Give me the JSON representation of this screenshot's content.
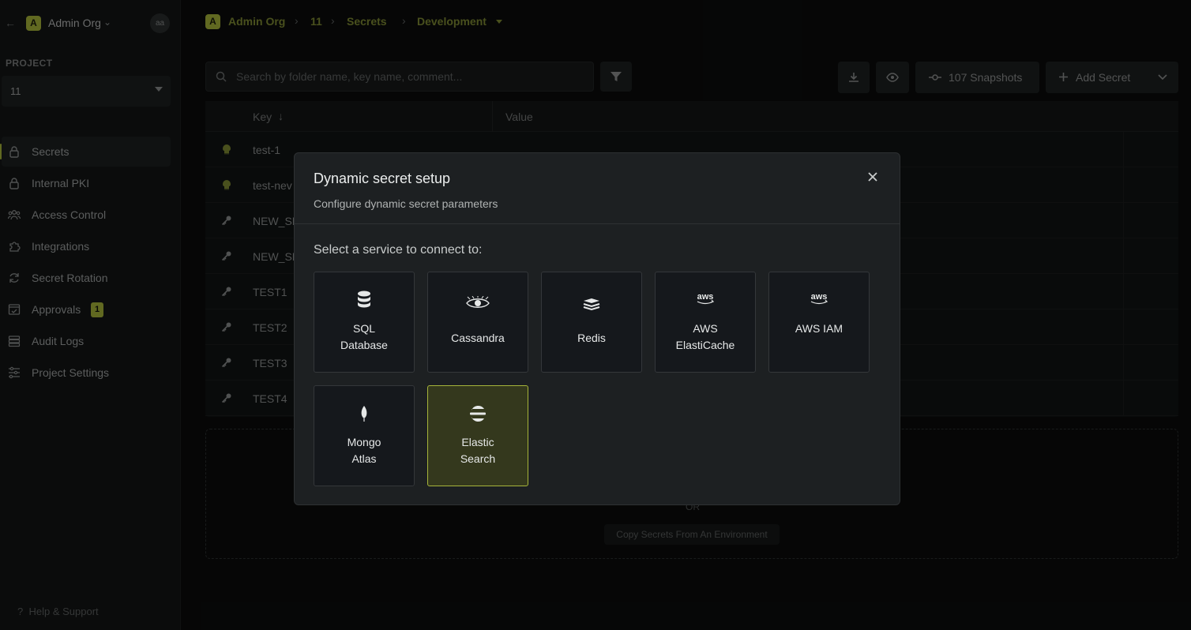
{
  "sidebar": {
    "org_initial": "A",
    "org_name": "Admin Org",
    "avatar": "aa",
    "project_label": "PROJECT",
    "project_value": "11",
    "items": [
      {
        "label": "Secrets",
        "icon": "lock-icon",
        "active": true
      },
      {
        "label": "Internal PKI",
        "icon": "lock-icon"
      },
      {
        "label": "Access Control",
        "icon": "users-icon"
      },
      {
        "label": "Integrations",
        "icon": "puzzle-icon"
      },
      {
        "label": "Secret Rotation",
        "icon": "rotate-icon"
      },
      {
        "label": "Approvals",
        "icon": "check-square-icon",
        "badge": "1"
      },
      {
        "label": "Audit Logs",
        "icon": "list-icon"
      },
      {
        "label": "Project Settings",
        "icon": "sliders-icon"
      }
    ],
    "help": "Help & Support"
  },
  "breadcrumb": {
    "org_initial": "A",
    "org": "Admin Org",
    "project": "11",
    "section": "Secrets",
    "environment": "Development"
  },
  "toolbar": {
    "search_placeholder": "Search by folder name, key name, comment...",
    "snapshots_label": "107 Snapshots",
    "add_secret_label": "Add Secret"
  },
  "table": {
    "col_key": "Key",
    "col_value": "Value",
    "rows": [
      {
        "key": "test-1",
        "type": "dynamic"
      },
      {
        "key": "test-nev",
        "type": "dynamic"
      },
      {
        "key": "NEW_SE",
        "type": "key"
      },
      {
        "key": "NEW_SE",
        "type": "key"
      },
      {
        "key": "TEST1",
        "type": "key"
      },
      {
        "key": "TEST2",
        "type": "key"
      },
      {
        "key": "TEST3",
        "type": "key"
      },
      {
        "key": "TEST4",
        "type": "key"
      }
    ]
  },
  "dropzone": {
    "or": "OR",
    "copy_label": "Copy Secrets From An Environment"
  },
  "modal": {
    "title": "Dynamic secret setup",
    "subtitle": "Configure dynamic secret parameters",
    "prompt": "Select a service to connect to:",
    "services": [
      {
        "line1": "SQL",
        "line2": "Database",
        "icon": "database-icon"
      },
      {
        "line1": "Cassandra",
        "line2": "",
        "icon": "cassandra-eye-icon"
      },
      {
        "line1": "Redis",
        "line2": "",
        "icon": "redis-stack-icon"
      },
      {
        "line1": "AWS",
        "line2": "ElastiCache",
        "icon": "aws-logo-icon"
      },
      {
        "line1": "AWS IAM",
        "line2": "",
        "icon": "aws-logo-icon"
      },
      {
        "line1": "Mongo",
        "line2": "Atlas",
        "icon": "mongodb-leaf-icon"
      },
      {
        "line1": "Elastic",
        "line2": "Search",
        "icon": "elasticsearch-icon",
        "selected": true
      }
    ]
  },
  "colors": {
    "accent": "#a7b53a",
    "background": "#0b0c0c",
    "modal": "#1d2022"
  }
}
